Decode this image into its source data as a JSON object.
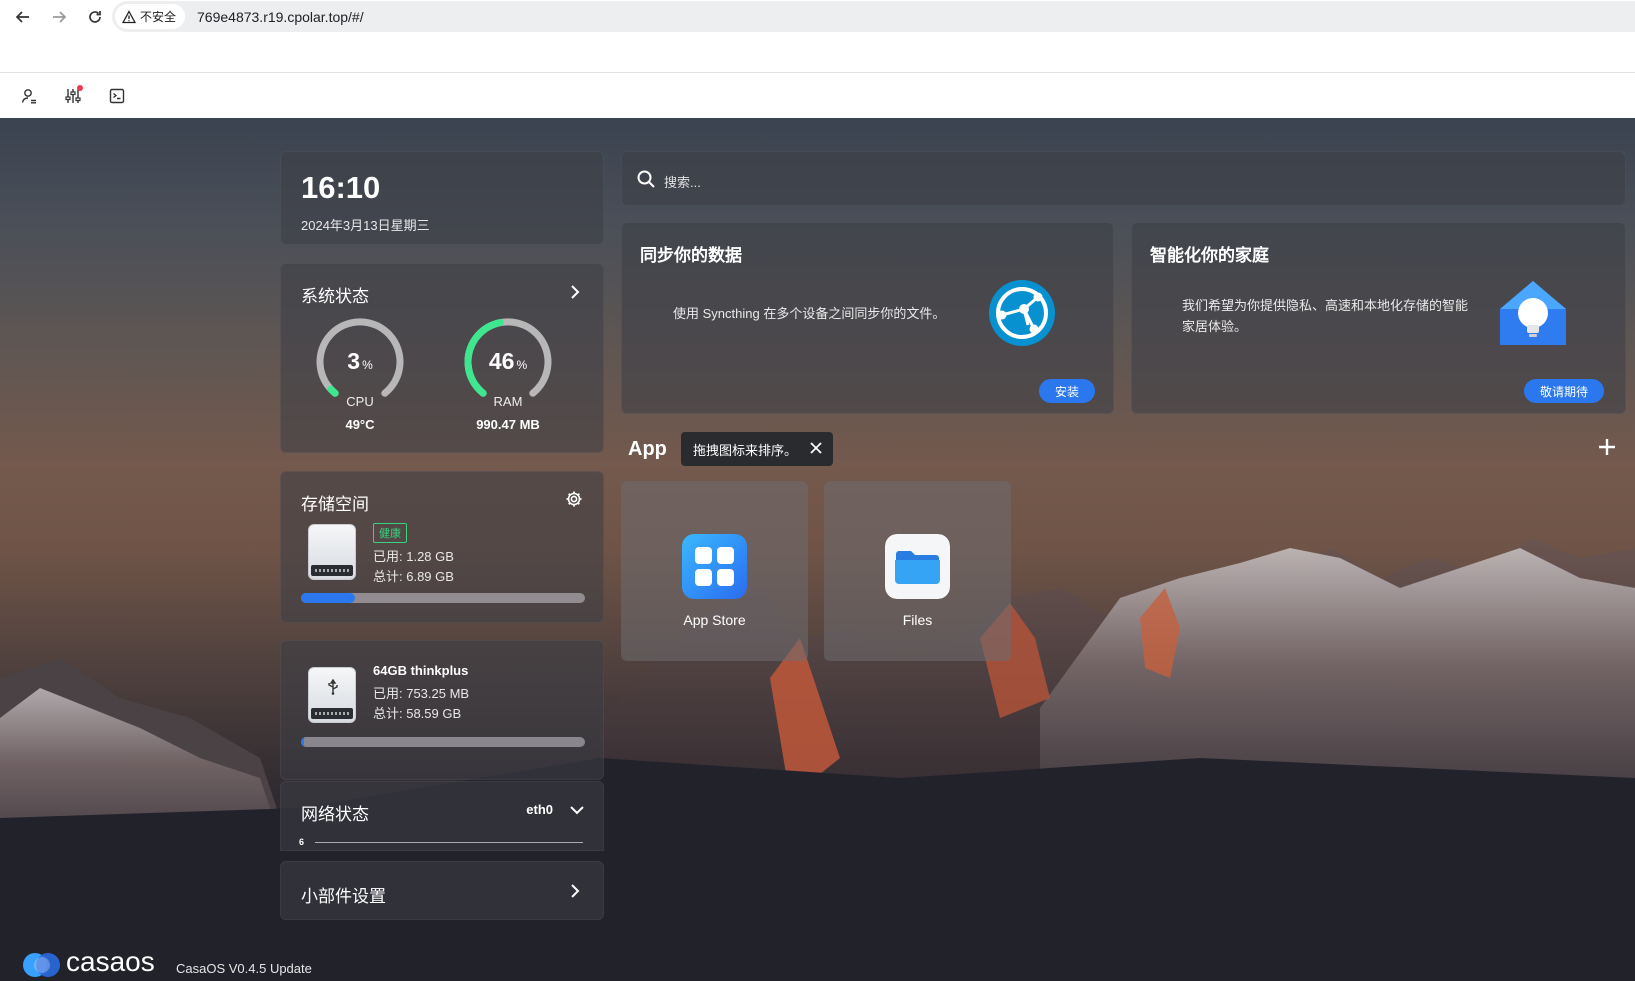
{
  "browser": {
    "security_label": "不安全",
    "url": "769e4873.r19.cpolar.top/#/"
  },
  "clock": {
    "time": "16:10",
    "date": "2024年3月13日星期三"
  },
  "system_status": {
    "title": "系统状态",
    "cpu": {
      "percent": "3",
      "unit": "%",
      "label": "CPU",
      "value": "49°C",
      "fraction": 0.03
    },
    "ram": {
      "percent": "46",
      "unit": "%",
      "label": "RAM",
      "value": "990.47 MB",
      "fraction": 0.46
    }
  },
  "storage": {
    "title": "存储空间",
    "health": "健康",
    "used": "已用: 1.28 GB",
    "total": "总计: 6.89 GB",
    "usage_fraction": 0.19
  },
  "usb": {
    "name": "64GB thinkplus",
    "used": "已用: 753.25 MB",
    "total": "总计: 58.59 GB",
    "usage_fraction": 0.01
  },
  "network": {
    "title": "网络状态",
    "interface": "eth0",
    "scale": "6"
  },
  "widget_settings": {
    "title": "小部件设置"
  },
  "search": {
    "placeholder": "搜索..."
  },
  "promos": [
    {
      "title": "同步你的数据",
      "desc": "使用 Syncthing 在多个设备之间同步你的文件。",
      "button": "安装"
    },
    {
      "title": "智能化你的家庭",
      "desc": "我们希望为你提供隐私、高速和本地化存储的智能家居体验。",
      "button": "敬请期待"
    }
  ],
  "apps": {
    "section_label": "App",
    "tooltip": "拖拽图标来排序。",
    "items": [
      {
        "name": "App Store"
      },
      {
        "name": "Files"
      }
    ]
  },
  "footer": {
    "logo_text": "casaos",
    "version": "CasaOS V0.4.5 Update"
  },
  "colors": {
    "accent": "#2b78ee",
    "gauge_green": "#3ee78f",
    "health": "#38d37c"
  }
}
